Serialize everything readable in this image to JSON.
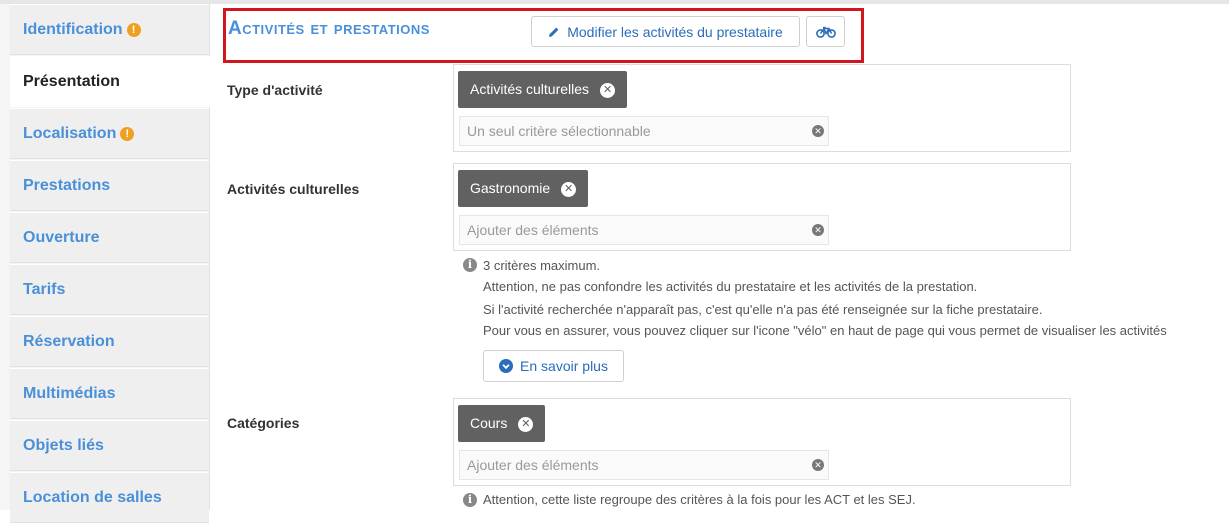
{
  "sidebar": {
    "items": [
      {
        "label": "Identification",
        "warning": true
      },
      {
        "label": "Présentation",
        "active": true
      },
      {
        "label": "Localisation",
        "warning": true
      },
      {
        "label": "Prestations"
      },
      {
        "label": "Ouverture"
      },
      {
        "label": "Tarifs"
      },
      {
        "label": "Réservation"
      },
      {
        "label": "Multimédias"
      },
      {
        "label": "Objets liés"
      },
      {
        "label": "Location de salles"
      }
    ],
    "warning_glyph": "!"
  },
  "header": {
    "title": "Activités et prestations",
    "modify_button_label": "Modifier les activités du prestataire",
    "modify_button_icon": "pencil-icon",
    "bike_button_icon": "bicycle-icon"
  },
  "form": {
    "type_activite": {
      "label": "Type d'activité",
      "tag": "Activités culturelles",
      "placeholder": "Un seul critère sélectionnable"
    },
    "activites_culturelles": {
      "label": "Activités culturelles",
      "tag": "Gastronomie",
      "placeholder": "Ajouter des éléments",
      "help": [
        "3 critères maximum.",
        "Attention, ne pas confondre les activités du prestataire et les activités de la prestation.",
        "Si l'activité recherchée n'apparaît pas, c'est qu'elle n'a pas été renseignée sur la fiche prestataire.",
        "Pour vous en assurer, vous pouvez cliquer sur l'icone \"vélo\" en haut de page qui vous permet de visualiser les activités"
      ],
      "more_button_label": "En savoir plus"
    },
    "categories": {
      "label": "Catégories",
      "tag": "Cours",
      "placeholder": "Ajouter des éléments",
      "help": "Attention, cette liste regroupe des critères à la fois pour les ACT et les SEJ."
    }
  },
  "colors": {
    "accent": "#4a90d9",
    "link": "#2a6db8",
    "warning": "#f0a020",
    "highlight_box": "#d0161e",
    "tag_bg": "#616161"
  }
}
